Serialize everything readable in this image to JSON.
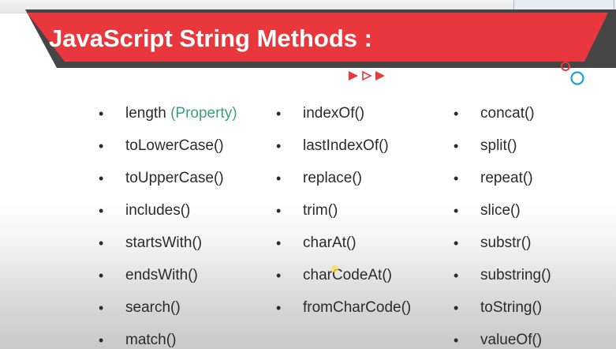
{
  "slide": {
    "title": "JavaScript String Methods :",
    "columns": [
      {
        "items": [
          {
            "text": "length",
            "extra": "(Property)"
          },
          {
            "text": "toLowerCase()"
          },
          {
            "text": "toUpperCase()"
          },
          {
            "text": "includes()"
          },
          {
            "text": "startsWith()"
          },
          {
            "text": "endsWith()"
          },
          {
            "text": "search()"
          },
          {
            "text": "match()"
          }
        ]
      },
      {
        "items": [
          {
            "text": "indexOf()"
          },
          {
            "text": "lastIndexOf()"
          },
          {
            "text": "replace()"
          },
          {
            "text": "trim()"
          },
          {
            "text": "charAt()"
          },
          {
            "text": "charCodeAt()"
          },
          {
            "text": "fromCharCode()"
          }
        ]
      },
      {
        "items": [
          {
            "text": "concat()"
          },
          {
            "text": "split()"
          },
          {
            "text": "repeat()"
          },
          {
            "text": "slice()"
          },
          {
            "text": "substr()"
          },
          {
            "text": "substring()"
          },
          {
            "text": "toString()"
          },
          {
            "text": "valueOf()"
          }
        ]
      }
    ]
  },
  "colors": {
    "banner_dark": "#454545",
    "banner_red": "#e8383d",
    "property_green": "#3aa17e",
    "circle_accent": "#1aa3d6"
  },
  "icons": [
    "play-triangles-icon",
    "circles-decoration-icon"
  ]
}
